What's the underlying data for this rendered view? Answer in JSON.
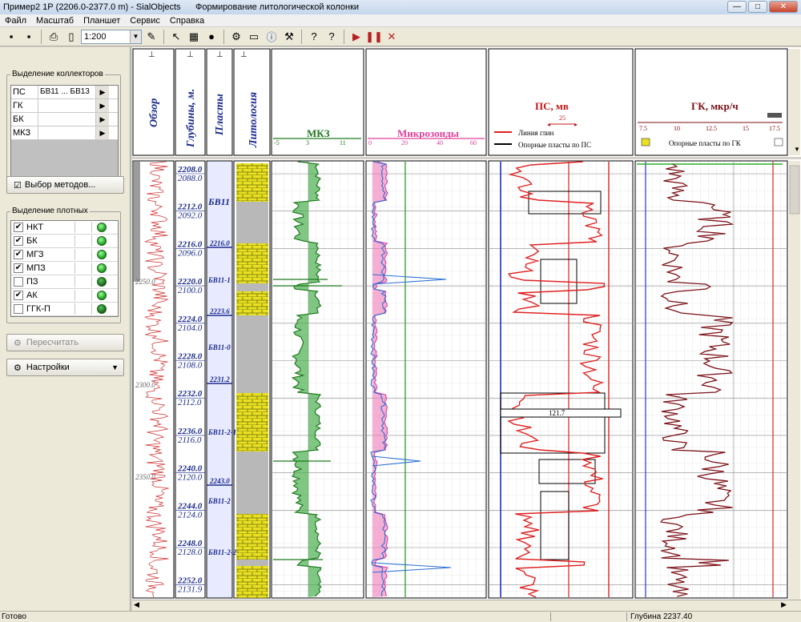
{
  "window": {
    "title": "Пример2  1Р  (2206.0-2377.0 m) - SialObjects",
    "subtitle": "Формирование литологической колонки",
    "minimize": "—",
    "maximize": "□",
    "close": "✕"
  },
  "menu": [
    "Файл",
    "Масштаб",
    "Планшет",
    "Сервис",
    "Справка"
  ],
  "toolbar": {
    "scale_value": "1:200"
  },
  "left_panel": {
    "collectors_title": "Выделение коллекторов",
    "collectors": [
      {
        "method": "ПС",
        "value": "БВ11 ... БВ13"
      },
      {
        "method": "ГК",
        "value": ""
      },
      {
        "method": "БК",
        "value": ""
      },
      {
        "method": "МКЗ",
        "value": ""
      }
    ],
    "method_select_label": "Выбор методов...",
    "dense_title": "Выделение плотных",
    "dense": [
      {
        "label": "НКТ",
        "checked": true,
        "status": "green"
      },
      {
        "label": "БК",
        "checked": true,
        "status": "green"
      },
      {
        "label": "МГЗ",
        "checked": true,
        "status": "green"
      },
      {
        "label": "МПЗ",
        "checked": true,
        "status": "green"
      },
      {
        "label": "ПЗ",
        "checked": false,
        "status": "dark"
      },
      {
        "label": "АК",
        "checked": true,
        "status": "green"
      },
      {
        "label": "ГГК-П",
        "checked": false,
        "status": "dark"
      }
    ],
    "recalc_label": "Пересчитать",
    "settings_label": "Настройки"
  },
  "tracks": {
    "overview_title": "Обзор",
    "depth_title": "Глубины, м.",
    "layers_title": "Пласты",
    "lithology_title": "Литология",
    "mkz": {
      "title": "МКЗ",
      "scale": [
        "-5",
        "3",
        "11"
      ]
    },
    "micro": {
      "title": "Микрозонды",
      "scale": [
        "0",
        "20",
        "40",
        "60"
      ]
    },
    "ps": {
      "title": "ПС, мв",
      "scale_step": "25",
      "legend": [
        "Линия глин",
        "Опорные пласты по ПС"
      ],
      "annotation": "121.7"
    },
    "gk": {
      "title": "ГК, мкр/ч",
      "scale": [
        "7.5",
        "10",
        "12.5",
        "15",
        "17.5"
      ],
      "legend": "Опорные пласты по ГК"
    }
  },
  "overview_labels": [
    "2250.0",
    "2300.0",
    "2350.0"
  ],
  "depths": [
    {
      "md": "2208.0",
      "tvd": "2088.0"
    },
    {
      "md": "2212.0",
      "tvd": "2092.0"
    },
    {
      "md": "2216.0",
      "tvd": "2096.0"
    },
    {
      "md": "2220.0",
      "tvd": "2100.0"
    },
    {
      "md": "2224.0",
      "tvd": "2104.0"
    },
    {
      "md": "2228.0",
      "tvd": "2108.0"
    },
    {
      "md": "2232.0",
      "tvd": "2112.0"
    },
    {
      "md": "2236.0",
      "tvd": "2116.0"
    },
    {
      "md": "2240.0",
      "tvd": "2120.0"
    },
    {
      "md": "2244.0",
      "tvd": "2124.0"
    },
    {
      "md": "2248.0",
      "tvd": "2128.0"
    },
    {
      "md": "2252.0",
      "tvd": "2131.9"
    }
  ],
  "layers": [
    {
      "name": "БВ11"
    },
    {
      "name": "БВ11-1",
      "top": "2216.0"
    },
    {
      "name": "БВ11-0",
      "top": "2223.6"
    },
    {
      "name": "БВ11-2-1",
      "top": "2231.2"
    },
    {
      "name": "БВ11-2",
      "top": "2243.0"
    },
    {
      "name": "БВ11-2-2"
    }
  ],
  "status": {
    "left": "Готово",
    "depth": "Глубина  2237.40"
  },
  "colors": {
    "gk": "#7a1016",
    "ps": "#e02020",
    "mkz": "#1e7a1e",
    "micro_pink": "#e0409a",
    "micro_blue": "#2a6fd6",
    "sand": "#e8e020",
    "shale": "#b8b8b8"
  }
}
